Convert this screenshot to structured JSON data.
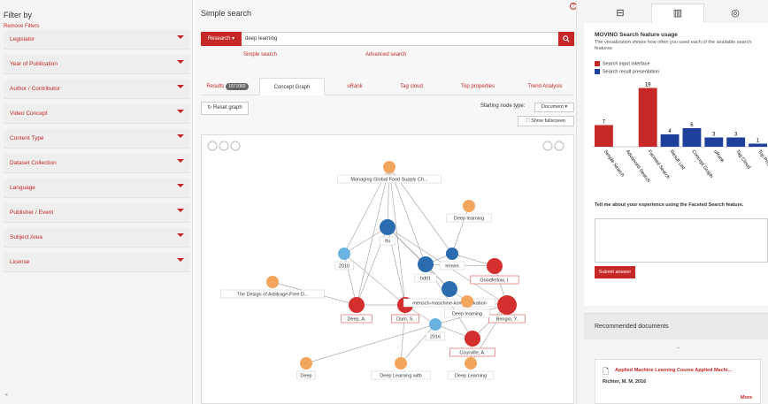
{
  "sidebar": {
    "title": "Filter by",
    "remove": "Remove Filters",
    "items": [
      "Legislator",
      "Year of Publication",
      "Author / Contributor",
      "Video Concept",
      "Content Type",
      "Dataset Collection",
      "Language",
      "Publisher / Event",
      "Subject Area",
      "License"
    ],
    "footer": "«"
  },
  "main": {
    "header": "Simple search",
    "help": "?",
    "research": "Research ▾",
    "query": "deep learning",
    "simple_link": "Simple search",
    "advanced_link": "Advanced search",
    "tabs": [
      "Results",
      "Concept Graph",
      "uRank",
      "Tag cloud",
      "Top properties",
      "Trend Analysis"
    ],
    "results_badge": "1071060",
    "reset": "Reset graph",
    "node_type_label": "Starting node type:",
    "node_type_value": "Document ▾",
    "fullscreen": "Show fullscreen"
  },
  "graph": {
    "nodes": [
      {
        "label": "Managing Global Food Supply Ch...",
        "kind": "doc"
      },
      {
        "label": "Deep learning",
        "kind": "doc"
      },
      {
        "label": "The Design of Arbitrage-Free D...",
        "kind": "doc"
      },
      {
        "label": "fhi",
        "kind": "key"
      },
      {
        "label": "hdtl1",
        "kind": "key"
      },
      {
        "label": "lernen",
        "kind": "key"
      },
      {
        "label": "2010",
        "kind": "year"
      },
      {
        "label": "2016",
        "kind": "year"
      },
      {
        "label": "Goodfellow, I.",
        "kind": "person"
      },
      {
        "label": "Bengio, Y.",
        "kind": "person"
      },
      {
        "label": "Deep, A.",
        "kind": "person"
      },
      {
        "label": "Dam, S.",
        "kind": "person"
      },
      {
        "label": "Courville, A.",
        "kind": "person"
      },
      {
        "label": "mensch-maschine-kommunikation",
        "kind": "key"
      },
      {
        "label": "Deep learning",
        "kind": "doc"
      },
      {
        "label": "Deep",
        "kind": "doc"
      },
      {
        "label": "Deep Learning with",
        "kind": "doc"
      },
      {
        "label": "Deep Learning",
        "kind": "doc"
      }
    ]
  },
  "right": {
    "chart_title": "MOVING Search feature usage",
    "chart_desc": "The visualization shows how often you used each of the available search features",
    "legend1": "Search input interface",
    "legend2": "Search result presentation",
    "question": "Tell me about your experience using the Faceted Search feature.",
    "submit": "Submit answer",
    "rec_header": "Recommended documents",
    "rec_title": "Applied Machine Learning Course Applied Machi...",
    "rec_author": "Richter, M. M. 2016",
    "rec_more": "More"
  },
  "chart_data": {
    "type": "bar",
    "categories": [
      "Simple Search",
      "Advanced Search",
      "Faceted Search",
      "Result List",
      "Concept Graph",
      "uRank",
      "Tag Cloud",
      "Top Properties"
    ],
    "series": [
      {
        "name": "Search input interface",
        "values": [
          7,
          0,
          19,
          0,
          0,
          0,
          0,
          0
        ]
      },
      {
        "name": "Search result presentation",
        "values": [
          0,
          0,
          0,
          4,
          6,
          3,
          3,
          1
        ]
      }
    ],
    "colors": [
      "#c62828",
      "#1e3f9a"
    ],
    "ylim": [
      0,
      20
    ]
  }
}
